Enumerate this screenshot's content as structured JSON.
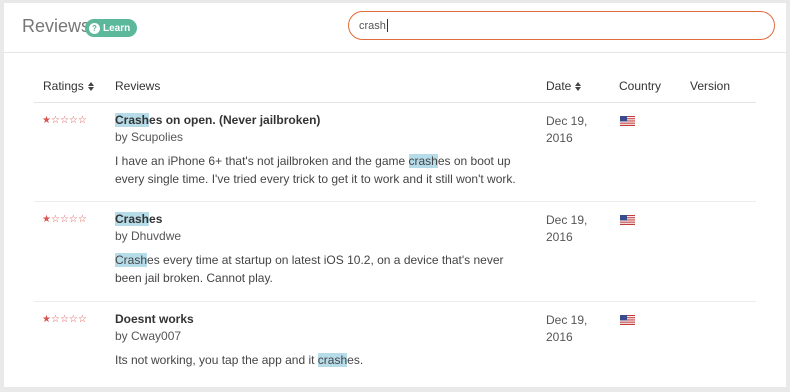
{
  "header": {
    "title": "Reviews",
    "learn_label": "Learn",
    "search_value": "crash"
  },
  "table": {
    "columns": {
      "ratings": "Ratings",
      "reviews": "Reviews",
      "date": "Date",
      "country": "Country",
      "version": "Version"
    }
  },
  "reviews": [
    {
      "title_hl": "Crash",
      "title_rest": "es on open. (Never jailbroken)",
      "author": "by Scupolies",
      "body_line1_pre": "I have an iPhone 6+ that's not jailbroken and the game ",
      "body_line1_hl": "crash",
      "body_line1_post": "es on boot up",
      "body_line2": "every single time. I've tried every trick to get it to work and it still won't work.",
      "date_line1": "Dec 19,",
      "date_line2": "2016",
      "rating": 1,
      "country": "US"
    },
    {
      "title_hl": "Crash",
      "title_rest": "es",
      "author": "by Dhuvdwe",
      "body_line1_hl": "Crash",
      "body_line1_post": "es every time at startup on latest iOS 10.2, on a device that's never",
      "body_line2": "been jail broken. Cannot play.",
      "date_line1": "Dec 19,",
      "date_line2": "2016",
      "rating": 1,
      "country": "US"
    },
    {
      "title": "Doesnt works",
      "author": "by Cway007",
      "body_pre": "Its not working, you tap the app and it ",
      "body_hl": "crash",
      "body_post": "es.",
      "date_line1": "Dec 19,",
      "date_line2": "2016",
      "rating": 1,
      "country": "US"
    }
  ],
  "colors": {
    "accent_search": "#e06b3a",
    "learn_badge": "#5cb89b",
    "star": "#d9534f",
    "highlight": "#b7dce9"
  }
}
